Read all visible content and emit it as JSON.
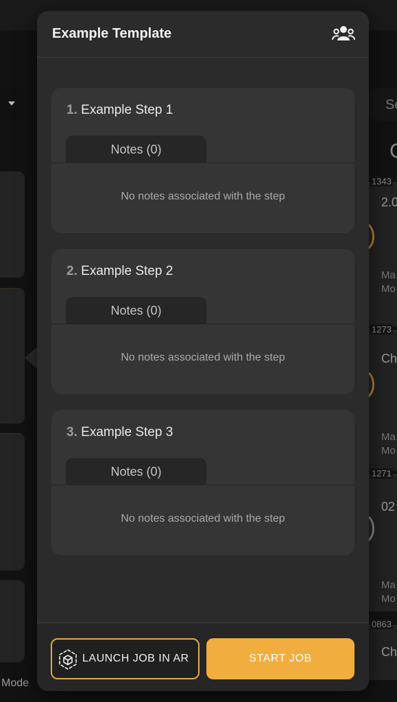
{
  "background": {
    "search_placeholder": "Sear",
    "big_letter": "C",
    "cards": [
      {
        "id": "1343",
        "text": "2.0",
        "meta1": "Ma",
        "meta2": "Mo"
      },
      {
        "id": "1273",
        "text": "Ch",
        "meta1": "Ma",
        "meta2": "Mo"
      },
      {
        "id": "1271",
        "text": "02",
        "meta1": "Ma",
        "meta2": "Mo"
      },
      {
        "id": "0863",
        "text": "Ch",
        "meta1": "",
        "meta2": ""
      }
    ],
    "mode_label": "Mode"
  },
  "popover": {
    "title": "Example Template",
    "header_icon": "people-group-icon",
    "steps": [
      {
        "number": "1.",
        "title": "Example Step 1",
        "notes_tab": "Notes (0)",
        "empty_text": "No notes associated with the step"
      },
      {
        "number": "2.",
        "title": "Example Step 2",
        "notes_tab": "Notes (0)",
        "empty_text": "No notes associated with the step"
      },
      {
        "number": "3.",
        "title": "Example Step 3",
        "notes_tab": "Notes (0)",
        "empty_text": "No notes associated with the step"
      }
    ],
    "footer": {
      "launch_ar_label": "LAUNCH JOB IN AR",
      "launch_ar_icon": "ar-cube-icon",
      "start_label": "START JOB"
    }
  },
  "colors": {
    "accent": "#f1ad3d",
    "panel": "#2b2b2b",
    "card": "#353535"
  }
}
